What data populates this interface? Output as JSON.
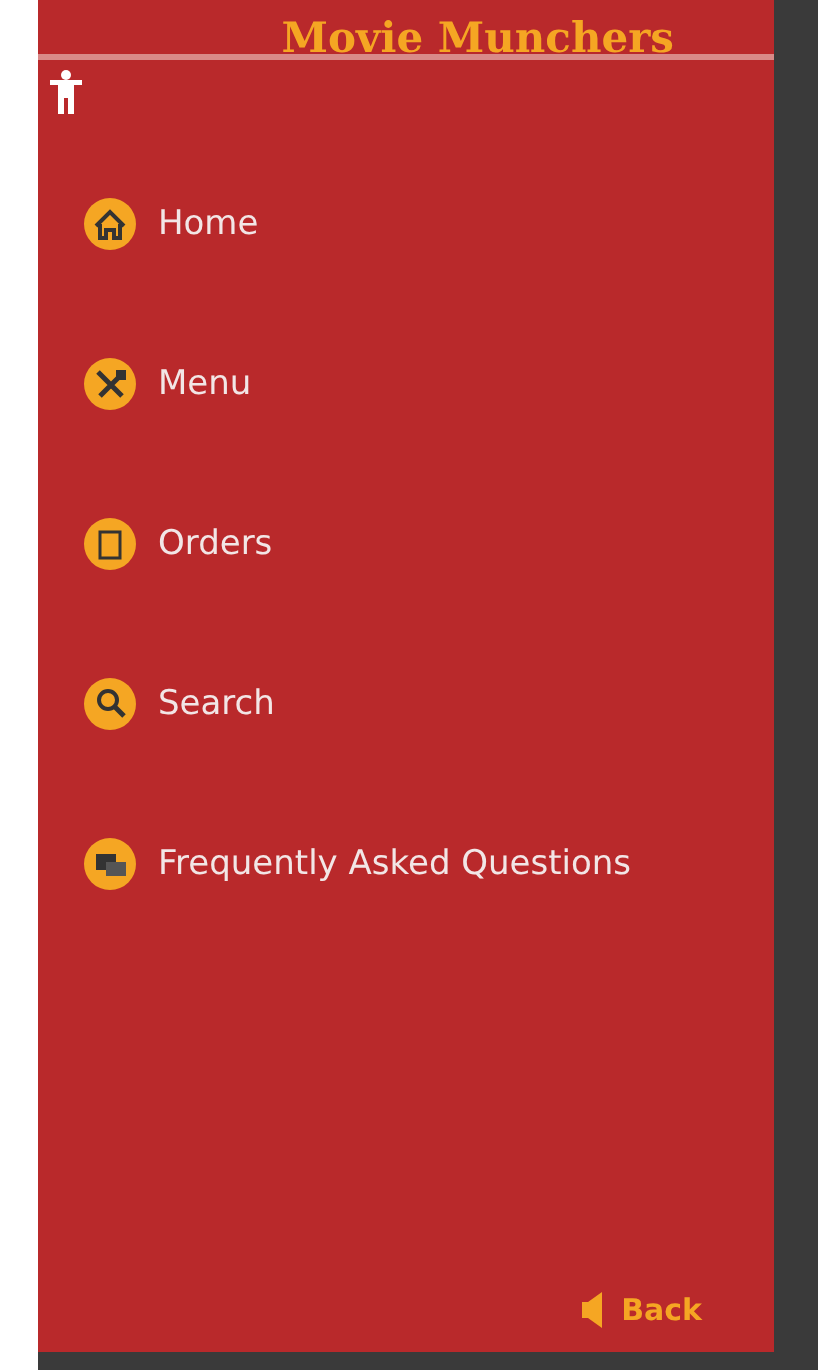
{
  "app_title": "Movie Munchers",
  "nav_items": [
    {
      "kind": "home",
      "label": "Home"
    },
    {
      "kind": "menu",
      "label": "Menu"
    },
    {
      "kind": "orders",
      "label": "Orders"
    },
    {
      "kind": "search",
      "label": "Search"
    },
    {
      "kind": "faq",
      "label": "Frequently Asked Questions"
    }
  ],
  "back": {
    "label": "Back"
  }
}
